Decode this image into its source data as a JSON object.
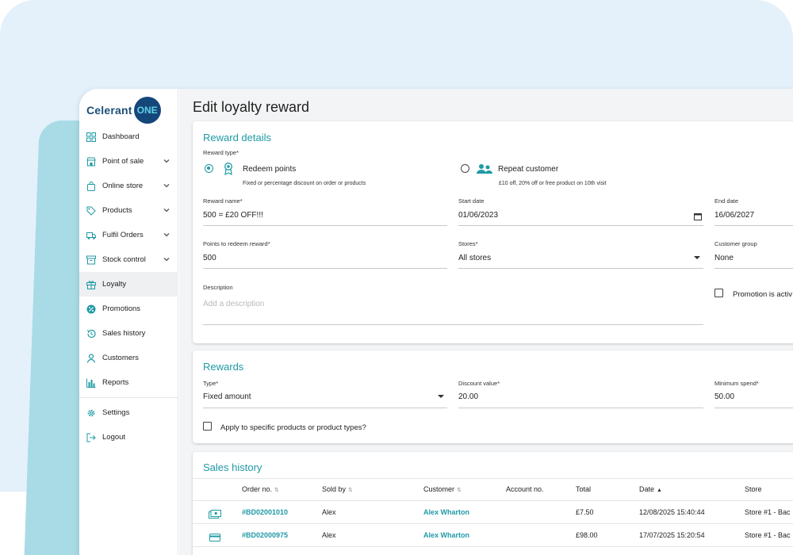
{
  "sidebar": {
    "logo_text": "Celerant",
    "logo_badge": "ONE",
    "items": [
      {
        "label": "Dashboard",
        "icon": "dashboard-icon",
        "chevron": false
      },
      {
        "label": "Point of sale",
        "icon": "store-icon",
        "chevron": true
      },
      {
        "label": "Online store",
        "icon": "shopping-bag-icon",
        "chevron": true
      },
      {
        "label": "Products",
        "icon": "tag-icon",
        "chevron": true
      },
      {
        "label": "Fulfil Orders",
        "icon": "truck-icon",
        "chevron": true
      },
      {
        "label": "Stock control",
        "icon": "box-icon",
        "chevron": true
      },
      {
        "label": "Loyalty",
        "icon": "gift-icon",
        "chevron": false,
        "active": true
      },
      {
        "label": "Promotions",
        "icon": "percent-badge-icon",
        "chevron": false
      },
      {
        "label": "Sales history",
        "icon": "history-icon",
        "chevron": false
      },
      {
        "label": "Customers",
        "icon": "person-icon",
        "chevron": false
      },
      {
        "label": "Reports",
        "icon": "bar-chart-icon",
        "chevron": false
      }
    ],
    "bottom_items": [
      {
        "label": "Settings",
        "icon": "gear-icon"
      },
      {
        "label": "Logout",
        "icon": "logout-icon"
      }
    ]
  },
  "page": {
    "title": "Edit loyalty reward"
  },
  "reward_details": {
    "title": "Reward details",
    "reward_type_label": "Reward type*",
    "option_redeem": {
      "label": "Redeem points",
      "desc": "Fixed or percentage discount on order or products",
      "selected": true
    },
    "option_repeat": {
      "label": "Repeat customer",
      "desc": "£10 off, 20% off or free product on 10th visit",
      "selected": false
    },
    "reward_name_label": "Reward name*",
    "reward_name_value": "500 = £20 OFF!!!",
    "start_date_label": "Start date",
    "start_date_value": "01/06/2023",
    "end_date_label": "End date",
    "end_date_value": "16/06/2027",
    "points_label": "Points to redeem reward*",
    "points_value": "500",
    "stores_label": "Stores*",
    "stores_value": "All stores",
    "customer_group_label": "Customer group",
    "customer_group_value": "None",
    "description_label": "Description",
    "description_placeholder": "Add a description",
    "promotion_active_label": "Promotion is activ"
  },
  "rewards": {
    "title": "Rewards",
    "type_label": "Type*",
    "type_value": "Fixed amount",
    "discount_label": "Discount value*",
    "discount_value": "20.00",
    "min_spend_label": "Minimum spend*",
    "min_spend_value": "50.00",
    "apply_label": "Apply to specific products or product types?"
  },
  "sales_history": {
    "title": "Sales history",
    "columns": [
      "Order no.",
      "Sold by",
      "Customer",
      "Account no.",
      "Total",
      "Date",
      "Store"
    ],
    "rows": [
      {
        "order": "#BD02001010",
        "sold_by": "Alex",
        "customer": "Alex Wharton",
        "account": "",
        "total": "£7.50",
        "date": "12/08/2025 15:40:44",
        "store": "Store #1 - Bac",
        "icon": "cash-icon"
      },
      {
        "order": "#BD02000975",
        "sold_by": "Alex",
        "customer": "Alex Wharton",
        "account": "",
        "total": "£98.00",
        "date": "17/07/2025 15:20:54",
        "store": "Store #1 - Bac",
        "icon": "card-icon"
      }
    ]
  },
  "colors": {
    "accent": "#1f9aa6",
    "brand": "#15467a",
    "background": "#e4f1fb",
    "teal_band": "#a8dbe6"
  }
}
